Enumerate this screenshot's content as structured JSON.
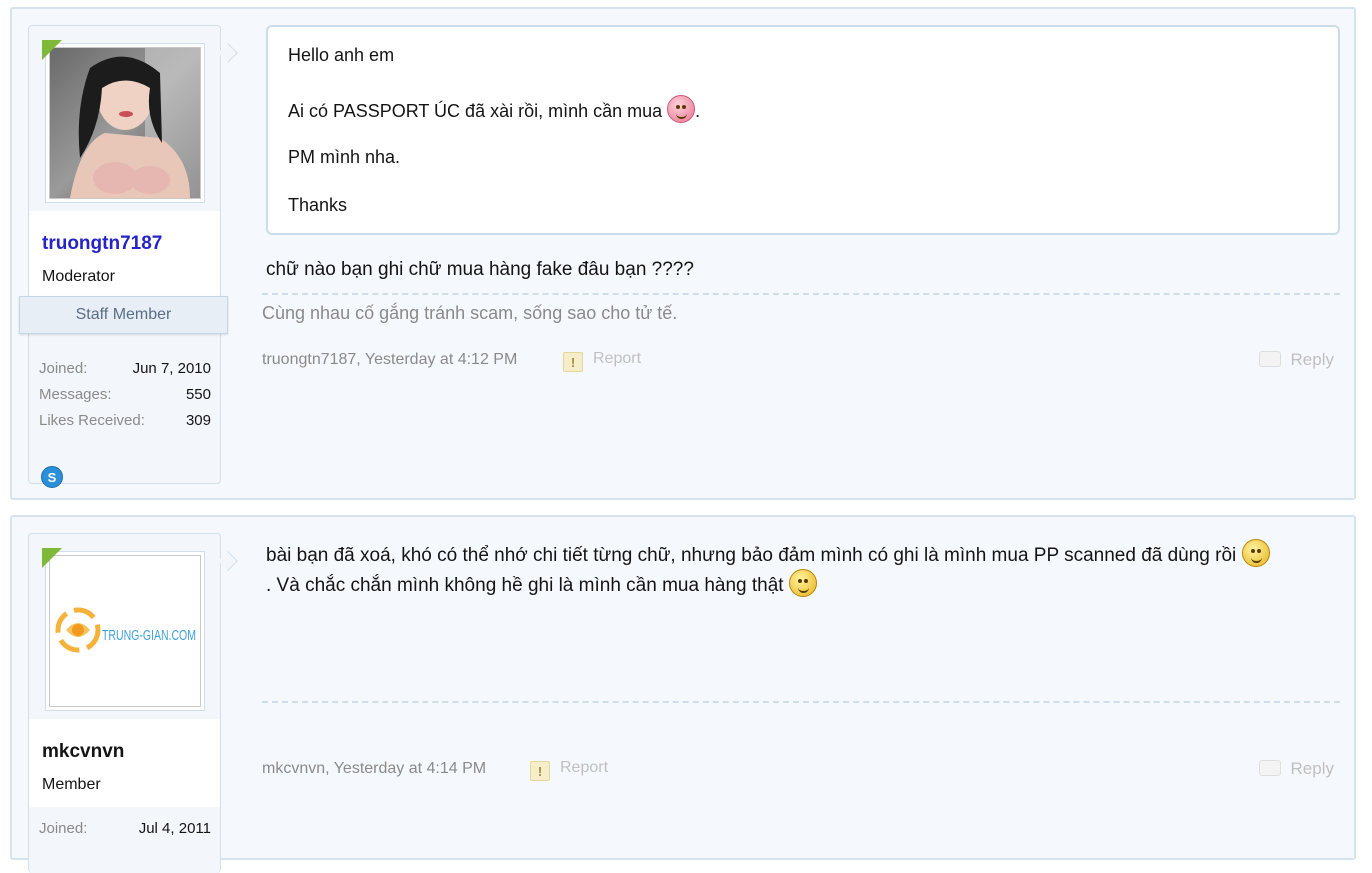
{
  "posts": [
    {
      "user": {
        "name": "truongtn7187",
        "title": "Moderator",
        "banner": "Staff Member",
        "stats": [
          {
            "label": "Joined:",
            "value": "Jun 7, 2010"
          },
          {
            "label": "Messages:",
            "value": "550"
          },
          {
            "label": "Likes Received:",
            "value": "309"
          }
        ],
        "contact_icon": "skype-icon"
      },
      "quote": {
        "line1": "Hello anh em",
        "line2": "Ai có PASSPORT ÚC đã xài rồi, mình cần mua",
        "line2_end": ".",
        "line3": "PM mình nha.",
        "line4": "Thanks"
      },
      "message": "chữ nào bạn ghi chữ mua hàng fake đâu bạn ????",
      "signature": "Cùng nhau cố gắng tránh scam, sống sao cho tử tế.",
      "meta": "truongtn7187, Yesterday at 4:12 PM",
      "report": "Report",
      "reply": "Reply"
    },
    {
      "user": {
        "name": "mkcvnvn",
        "title": "Member",
        "avatar_text": "TRUNG-GIAN.COM",
        "stats": [
          {
            "label": "Joined:",
            "value": "Jul 4, 2011"
          }
        ]
      },
      "message_line1": "bài bạn đã xoá, khó có thể nhớ chi tiết từng chữ, nhưng bảo đảm mình có ghi là mình mua PP scanned đã dùng rồi",
      "message_line2": ". Và chắc chắn mình không hề ghi là mình cần mua hàng thật",
      "meta": "mkcvnvn, Yesterday at 4:14 PM",
      "report": "Report",
      "reply": "Reply"
    }
  ],
  "colors": {
    "accent_online": "#7fb93a",
    "username_staff": "#2424c8",
    "border": "#d6e3ee"
  }
}
